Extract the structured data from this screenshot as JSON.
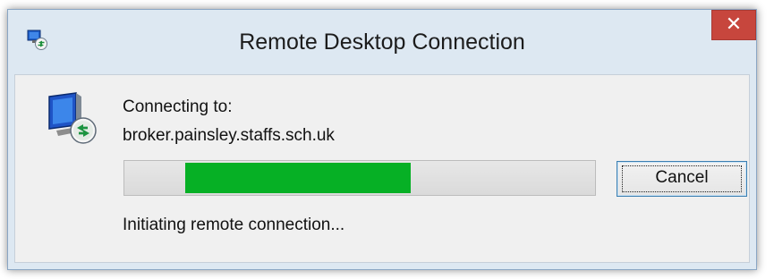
{
  "window": {
    "title": "Remote Desktop Connection",
    "close_label": "✕"
  },
  "dialog": {
    "connecting_label": "Connecting to:",
    "host": "broker.painsley.staffs.sch.uk",
    "progress": {
      "fill_start_fraction": 0.13,
      "fill_end_fraction": 0.61,
      "fill_color": "#06b025"
    },
    "cancel_label": "Cancel",
    "status": "Initiating remote connection..."
  },
  "icons": {
    "app": "remote-desktop-icon",
    "monitor": "remote-desktop-monitor-icon",
    "close": "close-icon"
  }
}
